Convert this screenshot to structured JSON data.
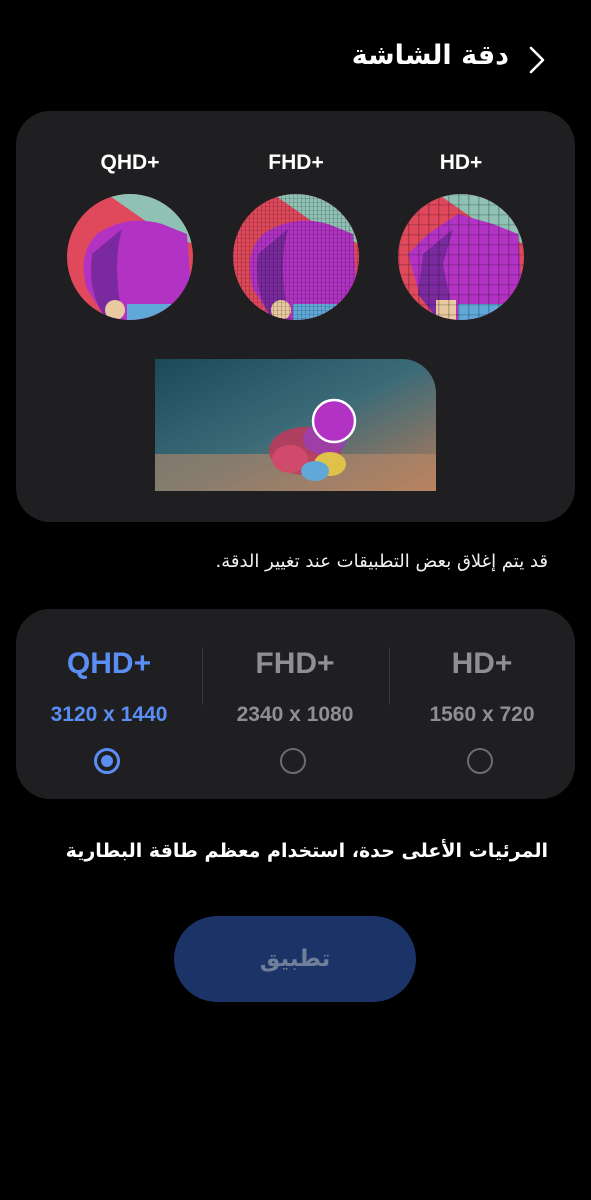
{
  "header": {
    "title": "دقة الشاشة"
  },
  "preview": {
    "labels": [
      "QHD+",
      "FHD+",
      "HD+"
    ]
  },
  "notes": {
    "apps_close": "قد يتم إغلاق بعض التطبيقات عند تغيير الدقة.",
    "battery": "المرئيات الأعلى حدة، استخدام معظم طاقة البطارية"
  },
  "options": [
    {
      "name": "QHD+",
      "dims": "3120 x 1440",
      "selected": true
    },
    {
      "name": "FHD+",
      "dims": "2340 x 1080",
      "selected": false
    },
    {
      "name": "HD+",
      "dims": "1560 x 720",
      "selected": false
    }
  ],
  "apply_label": "تطبيق",
  "colors": {
    "accent": "#5b8ef5",
    "card_bg": "#1f1f21",
    "apply_bg": "#1b3366"
  }
}
